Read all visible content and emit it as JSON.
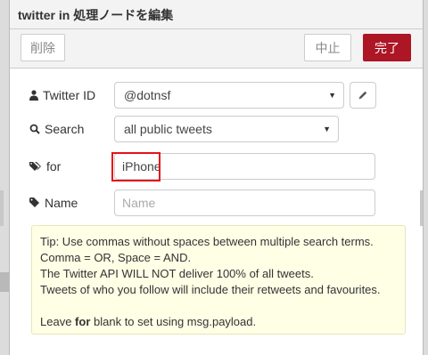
{
  "header": {
    "title": "twitter in 処理ノードを編集"
  },
  "toolbar": {
    "delete_label": "削除",
    "cancel_label": "中止",
    "done_label": "完了"
  },
  "form": {
    "twitter_id": {
      "label": "Twitter ID",
      "value": "@dotnsf",
      "icon": "user-icon"
    },
    "search": {
      "label": "Search",
      "value": "all public tweets",
      "icon": "search-icon"
    },
    "for": {
      "label": "for",
      "value": "iPhone",
      "icon": "tags-icon"
    },
    "name": {
      "label": "Name",
      "placeholder": "Name",
      "icon": "tag-icon"
    }
  },
  "tip": {
    "line1": "Tip: Use commas without spaces between multiple search terms.",
    "line2": "Comma = OR, Space = AND.",
    "line3": "The Twitter API WILL NOT deliver 100% of all tweets.",
    "line4": "Tweets of who you follow will include their retweets and favourites.",
    "line5_before": "Leave ",
    "line5_bold": "for",
    "line5_after": " blank to set using msg.payload."
  },
  "colors": {
    "done_button": "#ad1625",
    "highlight": "#e2121a",
    "tip_background": "#ffffe6"
  }
}
